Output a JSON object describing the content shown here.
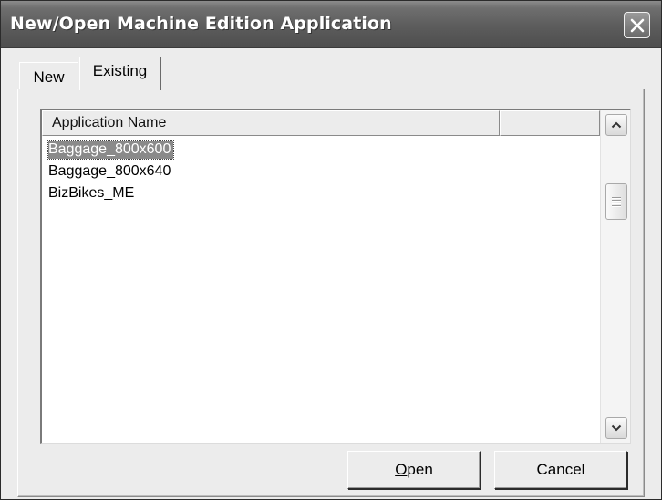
{
  "window": {
    "title": "New/Open Machine Edition Application",
    "close_icon": "close-x-icon"
  },
  "tabs": [
    {
      "label": "New",
      "active": false
    },
    {
      "label": "Existing",
      "active": true
    }
  ],
  "list": {
    "columns": [
      "Application Name",
      ""
    ],
    "rows": [
      {
        "name": "Baggage_800x600",
        "selected": true
      },
      {
        "name": "Baggage_800x640",
        "selected": false
      },
      {
        "name": "BizBikes_ME",
        "selected": false
      }
    ],
    "scrollbar": {
      "up_icon": "chevron-up-icon",
      "down_icon": "chevron-down-icon"
    }
  },
  "buttons": {
    "open_accel": "O",
    "open_rest": "pen",
    "cancel": "Cancel"
  },
  "colors": {
    "selection": "#8a8a8a",
    "titlebar": "#5c5c5c"
  }
}
